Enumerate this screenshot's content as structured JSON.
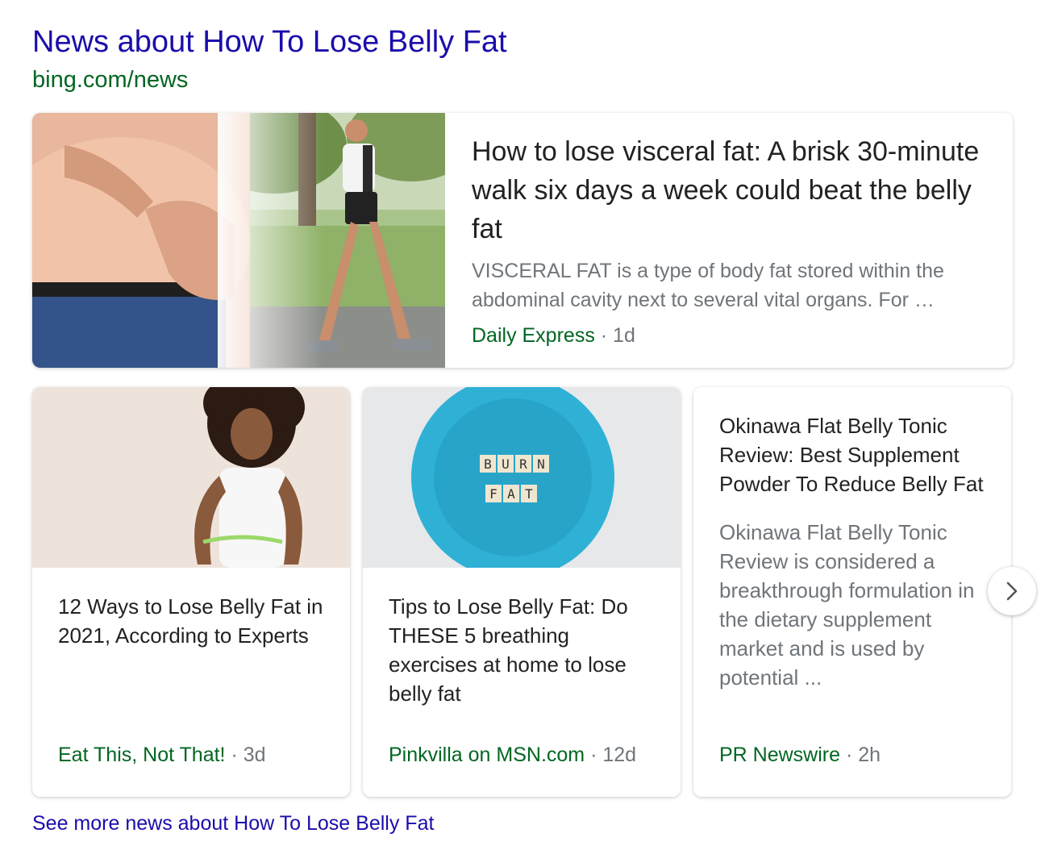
{
  "header": {
    "title": "News about How To Lose Belly Fat",
    "url": "bing.com/news"
  },
  "featured": {
    "title": "How to lose visceral fat: A brisk 30-minute walk six days a week could beat the belly fat",
    "snippet": "VISCERAL FAT is a type of body fat stored within the abdominal cavity next to several vital organs. For …",
    "source": "Daily Express",
    "age": "· 1d"
  },
  "cards": [
    {
      "title": "12 Ways to Lose Belly Fat in 2021, According to Experts",
      "source": "Eat This, Not That!",
      "age": "· 3d"
    },
    {
      "title": "Tips to Lose Belly Fat: Do THESE 5 breathing exercises at home to lose belly fat",
      "source": "Pinkvilla on MSN.com",
      "age": "· 12d",
      "tiles_row1": [
        "B",
        "U",
        "R",
        "N"
      ],
      "tiles_row2": [
        "F",
        "A",
        "T"
      ]
    },
    {
      "title": "Okinawa Flat Belly Tonic Review: Best Supplement Powder To Reduce Belly Fat",
      "snippet": "Okinawa Flat Belly Tonic Review is considered a breakthrough formulation in the dietary supplement market and is used by potential ...",
      "source": "PR Newswire",
      "age": "· 2h"
    }
  ],
  "navigation": {
    "next_icon": "chevron-right-icon"
  },
  "footer": {
    "see_more": "See more news about How To Lose Belly Fat"
  },
  "colors": {
    "title_link": "#1a0dab",
    "url_green": "#006621",
    "snippet_gray": "#70757a",
    "plate_blue": "#2fb1d6"
  }
}
